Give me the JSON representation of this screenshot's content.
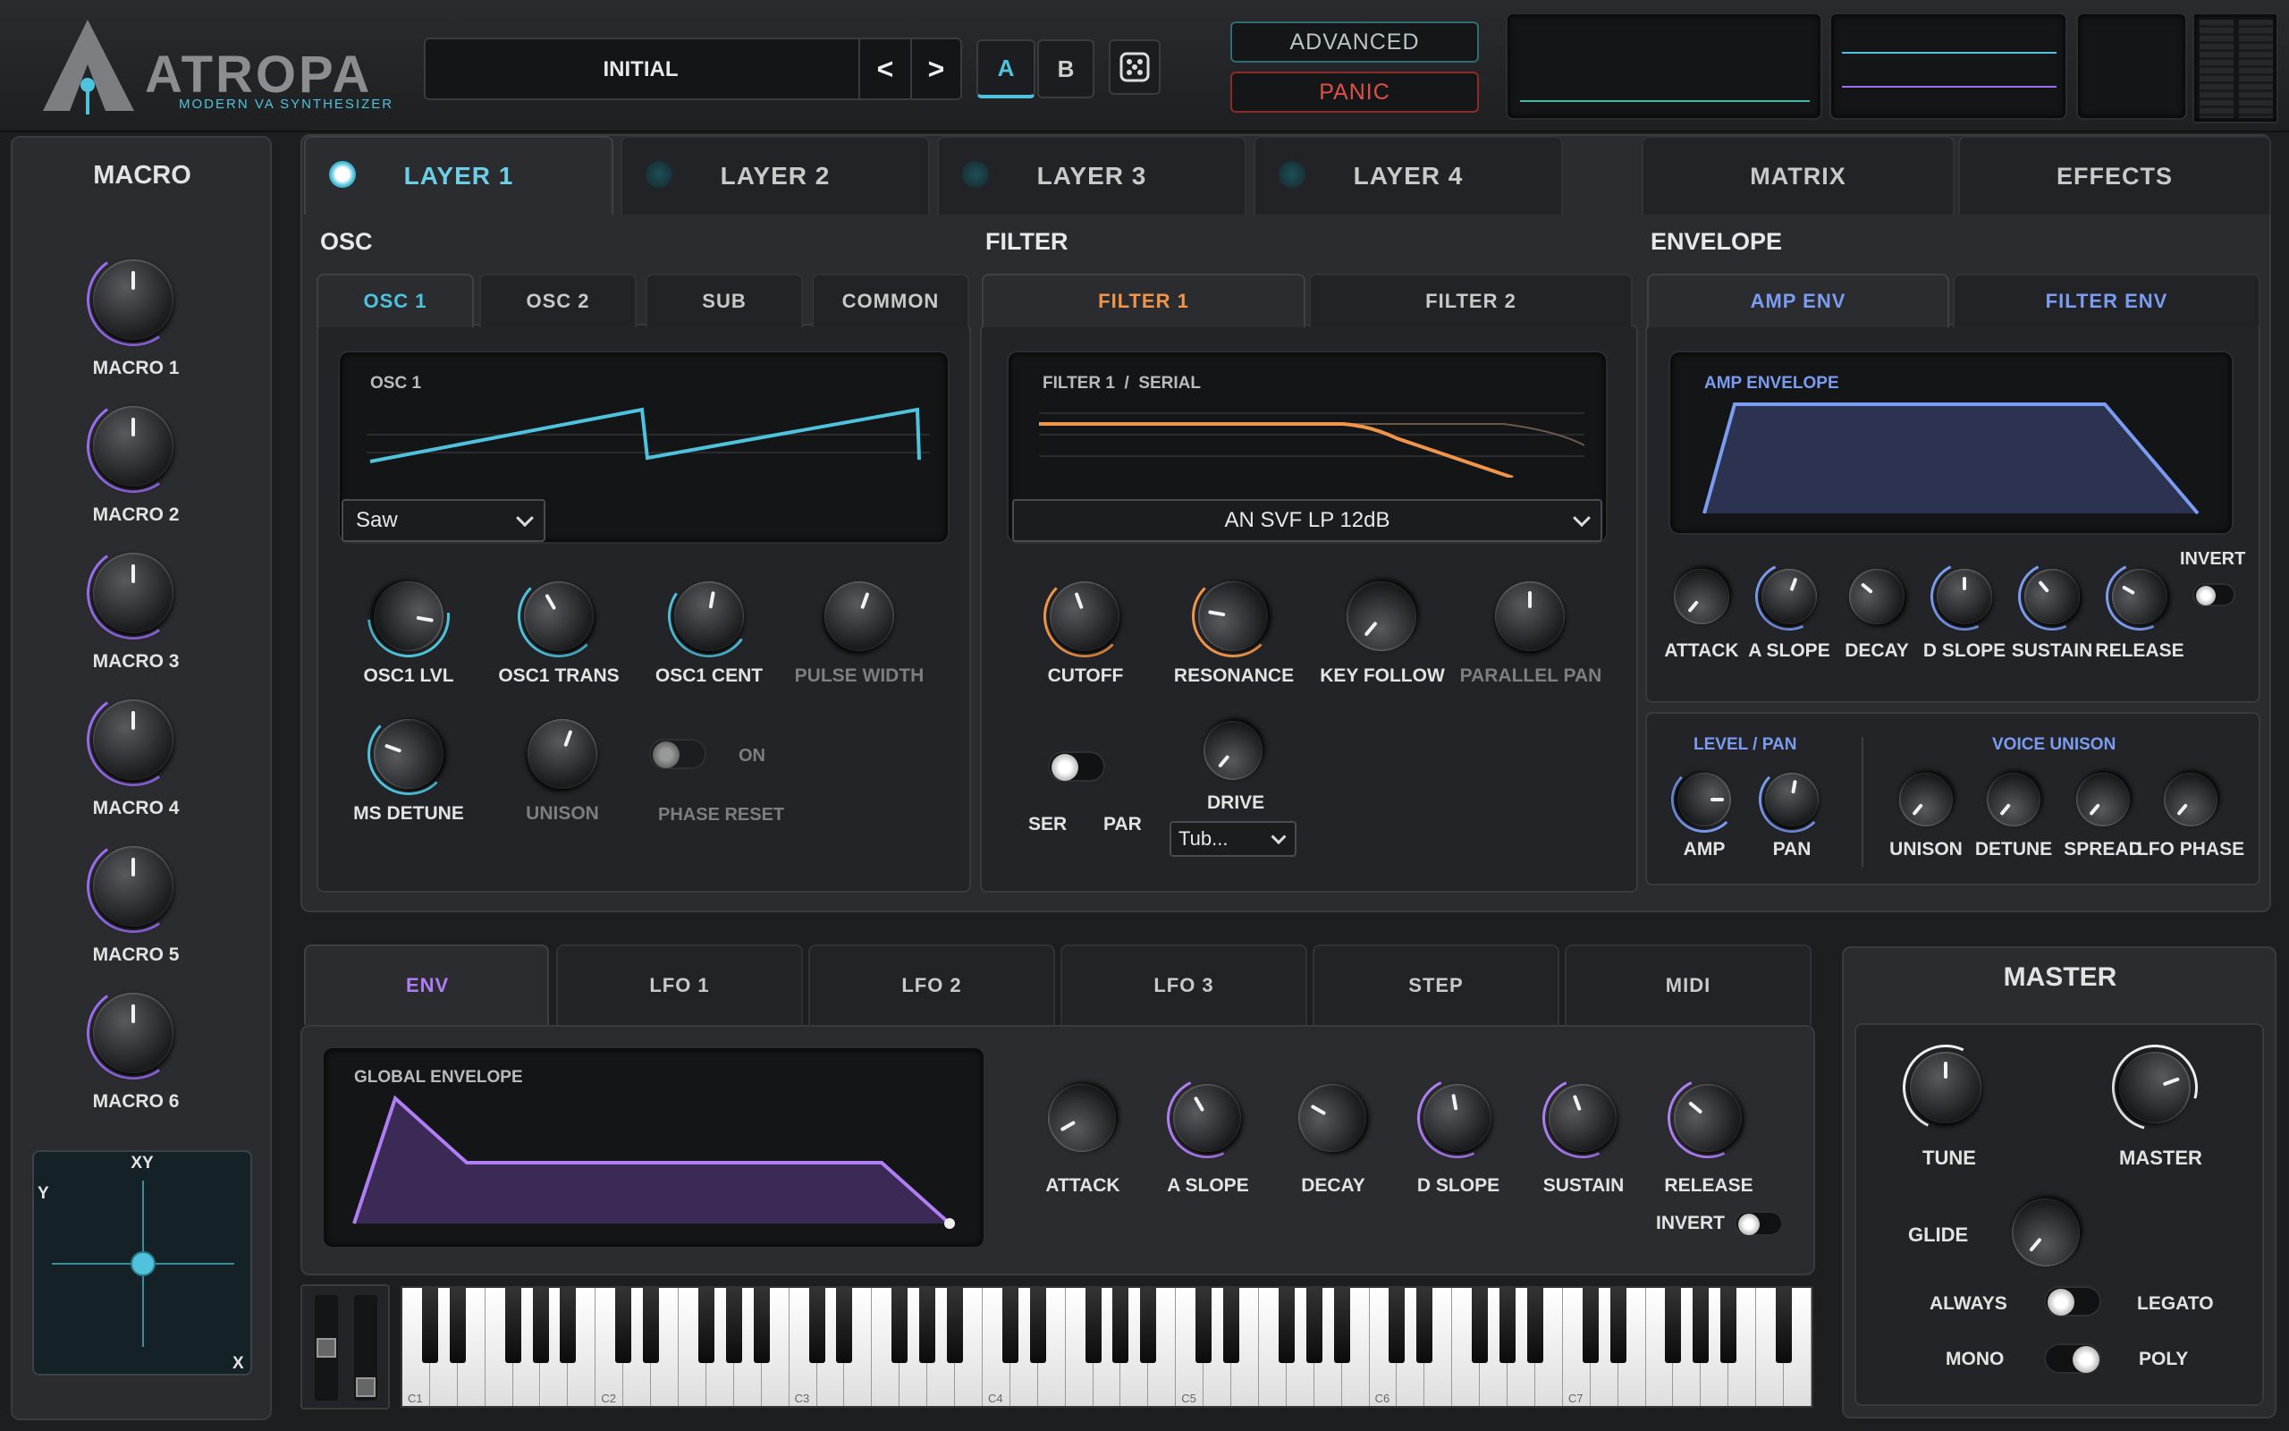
{
  "header": {
    "logo_text": "ATROPA",
    "logo_sub": "MODERN VA SYNTHESIZER",
    "preset_name": "INITIAL",
    "prev_label": "<",
    "next_label": ">",
    "a_label": "A",
    "b_label": "B",
    "advanced_label": "ADVANCED",
    "panic_label": "PANIC"
  },
  "macro": {
    "title": "MACRO",
    "items": [
      {
        "label": "MACRO 1"
      },
      {
        "label": "MACRO 2"
      },
      {
        "label": "MACRO 3"
      },
      {
        "label": "MACRO 4"
      },
      {
        "label": "MACRO 5"
      },
      {
        "label": "MACRO 6"
      }
    ],
    "xy": {
      "x_label": "X",
      "y_label": "Y",
      "title": "XY"
    }
  },
  "layer_tabs": [
    "LAYER 1",
    "LAYER 2",
    "LAYER 3",
    "LAYER 4"
  ],
  "right_tabs": [
    "MATRIX",
    "EFFECTS"
  ],
  "osc": {
    "section": "OSC",
    "tabs": [
      "OSC 1",
      "OSC 2",
      "SUB",
      "COMMON"
    ],
    "screen_title": "OSC 1",
    "waveform": "Saw",
    "knobs_row1": [
      "OSC1 LVL",
      "OSC1 TRANS",
      "OSC1 CENT",
      "PULSE WIDTH"
    ],
    "knobs_row2": [
      "MS DETUNE",
      "UNISON"
    ],
    "phase_reset": "PHASE RESET",
    "on_label": "ON"
  },
  "filter": {
    "section": "FILTER",
    "tabs": [
      "FILTER 1",
      "FILTER 2"
    ],
    "screen_title": "FILTER 1  /  SERIAL",
    "type": "AN SVF LP 12dB",
    "knobs": [
      "CUTOFF",
      "RESONANCE",
      "KEY FOLLOW",
      "PARALLEL PAN"
    ],
    "ser": "SER",
    "par": "PAR",
    "drive": "DRIVE",
    "drive_type": "Tub..."
  },
  "envelope": {
    "section": "ENVELOPE",
    "tabs": [
      "AMP ENV",
      "FILTER ENV"
    ],
    "screen_title": "AMP ENVELOPE",
    "invert": "INVERT",
    "knobs": [
      "ATTACK",
      "A SLOPE",
      "DECAY",
      "D SLOPE",
      "SUSTAIN",
      "RELEASE"
    ],
    "level_pan": "LEVEL / PAN",
    "voice_unison": "VOICE UNISON",
    "lp_knobs": [
      "AMP",
      "PAN"
    ],
    "vu_knobs": [
      "UNISON",
      "DETUNE",
      "SPREAD",
      "LFO PHASE"
    ]
  },
  "mod": {
    "tabs": [
      "ENV",
      "LFO 1",
      "LFO 2",
      "LFO 3",
      "STEP",
      "MIDI"
    ],
    "screen_title": "GLOBAL ENVELOPE",
    "knobs": [
      "ATTACK",
      "A SLOPE",
      "DECAY",
      "D SLOPE",
      "SUSTAIN",
      "RELEASE"
    ],
    "invert": "INVERT"
  },
  "keyboard": {
    "octaves": [
      "C1",
      "C2",
      "C3",
      "C4",
      "C5",
      "C6",
      "C7"
    ]
  },
  "master": {
    "title": "MASTER",
    "tune": "TUNE",
    "master": "MASTER",
    "glide": "GLIDE",
    "always": "ALWAYS",
    "legato": "LEGATO",
    "mono": "MONO",
    "poly": "POLY"
  },
  "colors": {
    "accent_osc": "#4fc3dd",
    "accent_filter": "#f0954a",
    "accent_env": "#7b9cf0",
    "accent_mod": "#b07ef5",
    "panic": "#e0504a"
  }
}
